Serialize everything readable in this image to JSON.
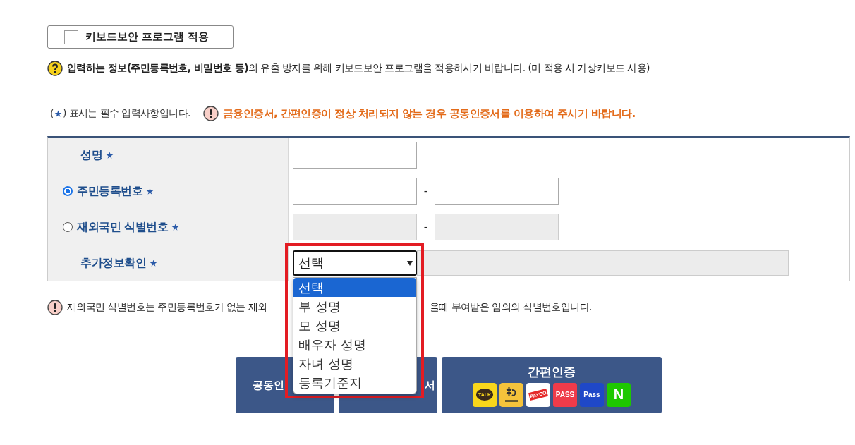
{
  "keyboard_security": {
    "label": "키보드보안 프로그램 적용",
    "checked": false
  },
  "notice": "**입력하는 정보(주민등록번호, 비밀번호 등)**의 유출 방지를 위해 키보드보안 프로그램을 적용하시기 바랍니다. (미 적용 시 가상키보드 사용)",
  "required_note": {
    "before": "(",
    "after": ") 표시는 필수 입력사항입니다."
  },
  "warning": "금융인증서, 간편인증이 정상 처리되지 않는 경우 공동인증서를 이용하여 주시기 바랍니다.",
  "form": [
    {
      "label": "성명",
      "kind": "text",
      "fields": [
        {
          "disabled": false
        }
      ]
    },
    {
      "label": "주민등록번호",
      "kind": "radio",
      "selected": true,
      "separator": "-",
      "fields": [
        {
          "disabled": false
        },
        {
          "disabled": false
        }
      ]
    },
    {
      "label": "재외국민 식별번호",
      "kind": "radio",
      "selected": false,
      "separator": "-",
      "fields": [
        {
          "disabled": true
        },
        {
          "disabled": true
        }
      ]
    },
    {
      "label": "추가정보확인",
      "kind": "select",
      "value": "선택",
      "open": true,
      "options": [
        {
          "label": "선택",
          "selected": true
        },
        {
          "label": "부 성명",
          "selected": false
        },
        {
          "label": "모 성명",
          "selected": false
        },
        {
          "label": "배우자 성명",
          "selected": false
        },
        {
          "label": "자녀 성명",
          "selected": false
        },
        {
          "label": "등록기준지",
          "selected": false
        }
      ],
      "fields": [
        {
          "disabled": true
        }
      ]
    }
  ],
  "footnote": [
    "재외국민 식별번호는 주민등록번호가 없는 재외",
    "을때 부여받은 임의의 식별번호입니다."
  ],
  "buttons": [
    {
      "kind": "cut_right",
      "label": "공동인"
    },
    {
      "kind": "cut_left",
      "label": "서"
    },
    {
      "kind": "simple",
      "label": "간편인증",
      "logos": [
        {
          "kind": "talk",
          "text": "TALK"
        },
        {
          "kind": "kb"
        },
        {
          "kind": "payco",
          "text": "PAYCO"
        },
        {
          "kind": "pass",
          "text": "PASS"
        },
        {
          "kind": "samsung",
          "text": "Pass"
        },
        {
          "kind": "naver",
          "text": "N"
        }
      ]
    }
  ]
}
